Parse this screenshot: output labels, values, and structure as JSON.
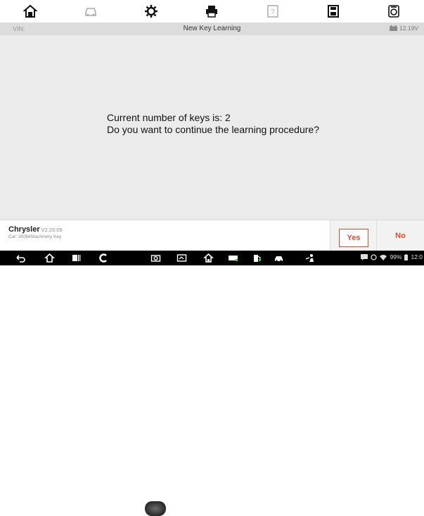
{
  "toolbar": {
    "icons": [
      "home-icon",
      "vehicle-menu-icon",
      "settings-icon",
      "print-icon",
      "help-icon",
      "save-data-icon",
      "data-logging-icon"
    ]
  },
  "info_bar": {
    "vin_label": "VIN:",
    "title": "New Key Learning",
    "voltage": "12.19V"
  },
  "dialog": {
    "line1": "Current number of keys is: 2",
    "line2": "Do you want to continue the learning procedure?"
  },
  "footer": {
    "make": "Chrysler",
    "version": "V2.20.05",
    "car": "Car: 300M/Machinery Key",
    "yes_label": "Yes",
    "no_label": "No"
  },
  "status_bar": {
    "battery": "99%",
    "time": "12:0"
  },
  "colors": {
    "accent": "#e24a2a",
    "info_bar_bg": "#dcdcdc",
    "content_bg": "#ebebeb"
  }
}
